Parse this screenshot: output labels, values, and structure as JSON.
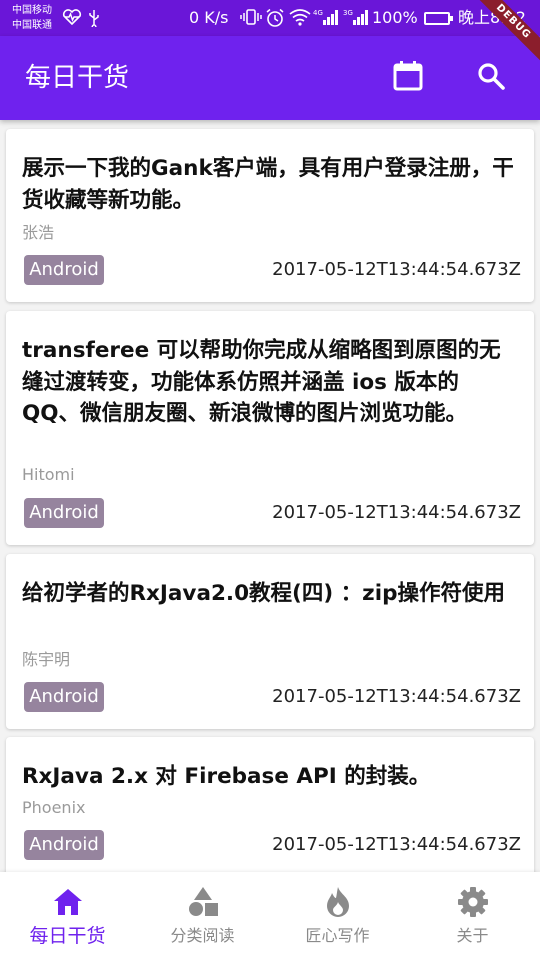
{
  "status_bar": {
    "carrier_1": "中国移动",
    "carrier_2": "中国联通",
    "speed": "0 K/s",
    "battery": "100%",
    "time": "晚上8:52"
  },
  "debug_banner": "DEBUG",
  "app_bar": {
    "title": "每日干货",
    "icons": [
      "calendar-icon",
      "search-icon"
    ]
  },
  "articles": [
    {
      "title": "展示一下我的Gank客户端，具有用户登录注册，干货收藏等新功能。",
      "author": "张浩",
      "tag": "Android",
      "date": "2017-05-12T13:44:54.673Z"
    },
    {
      "title": "transferee 可以帮助你完成从缩略图到原图的无缝过渡转变，功能体系仿照并涵盖 ios 版本的 QQ、微信朋友圈、新浪微博的图片浏览功能。",
      "author": "Hitomi",
      "tag": "Android",
      "date": "2017-05-12T13:44:54.673Z"
    },
    {
      "title": "给初学者的RxJava2.0教程(四) ：zip操作符使用",
      "author": "陈宇明",
      "tag": "Android",
      "date": "2017-05-12T13:44:54.673Z"
    },
    {
      "title": "RxJava 2.x 对 Firebase API 的封装。",
      "author": "Phoenix",
      "tag": "Android",
      "date": "2017-05-12T13:44:54.673Z"
    }
  ],
  "bottom_nav": [
    {
      "label": "每日干货",
      "icon": "home-icon",
      "active": true
    },
    {
      "label": "分类阅读",
      "icon": "shapes-icon",
      "active": false
    },
    {
      "label": "匠心写作",
      "icon": "flame-icon",
      "active": false
    },
    {
      "label": "关于",
      "icon": "gear-icon",
      "active": false
    }
  ],
  "colors": {
    "app_bar": "#6f22ee",
    "status_bar": "#6a16d8",
    "active_nav": "#6f22ee",
    "inactive_nav": "#8a8a8a",
    "tag_chip": "#96849e",
    "debug_ribbon": "#8b1e2c"
  }
}
